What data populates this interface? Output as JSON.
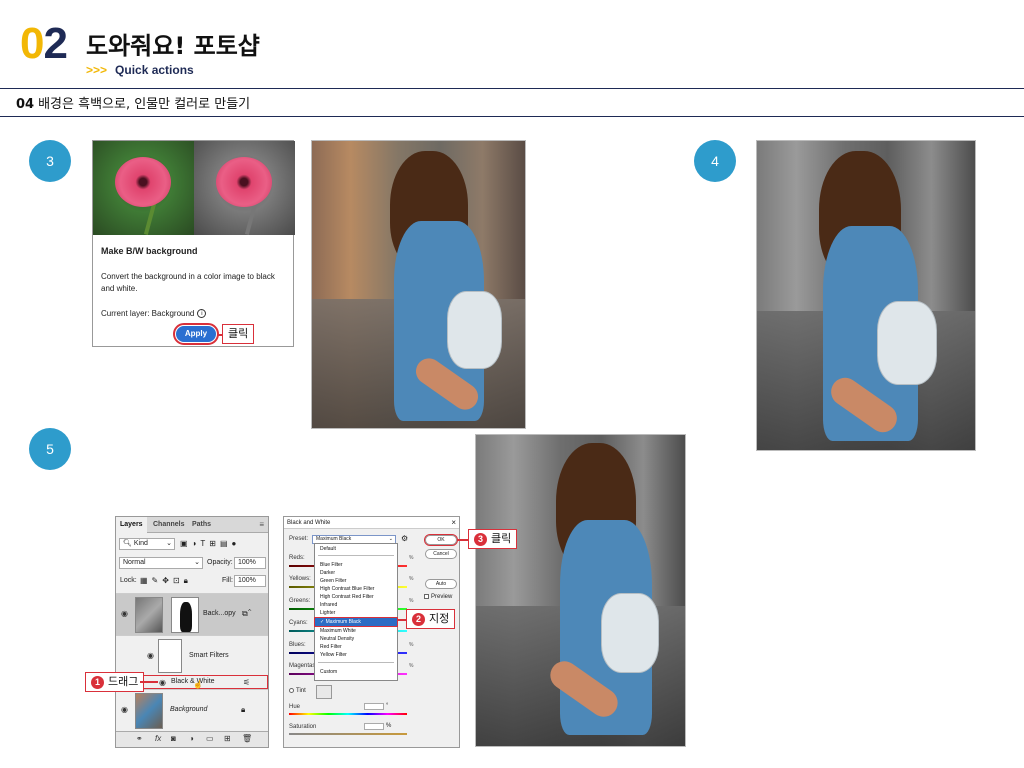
{
  "header": {
    "chapter_num_first": "0",
    "chapter_num_second": "2",
    "title": "도와줘요! 포토샵",
    "sub_arrows": ">>>",
    "subtitle": "Quick actions",
    "section_num": "04",
    "section_title": "배경은 흑백으로, 인물만 컬러로 만들기"
  },
  "steps": {
    "s3": "3",
    "s4": "4",
    "s5": "5"
  },
  "quick_action": {
    "heading": "Make B/W background",
    "description": "Convert the background in a color image to black and white.",
    "current_layer": "Current layer: Background",
    "info_icon": "i",
    "apply_label": "Apply",
    "callout": "클릭"
  },
  "layers_panel": {
    "tabs": [
      "Layers",
      "Channels",
      "Paths"
    ],
    "kind": "Kind",
    "blend_mode": "Normal",
    "opacity_label": "Opacity:",
    "opacity_value": "100%",
    "lock_label": "Lock:",
    "fill_label": "Fill:",
    "fill_value": "100%",
    "layer_copy": "Back...opy",
    "smart_filters": "Smart Filters",
    "bw_filter": "Black & White",
    "background": "Background",
    "callout_num": "1",
    "callout_text": "드래그"
  },
  "bw_dialog": {
    "title": "Black and White",
    "close": "×",
    "preset_label": "Preset:",
    "preset_value": "Maximum Black",
    "options": [
      "Default",
      "Blue Filter",
      "Darker",
      "Green Filter",
      "High Contrast Blue Filter",
      "High Contrast Red Filter",
      "Infrared",
      "Lighter",
      "✓ Maximum Black",
      "Maximum White",
      "Neutral Density",
      "Red Filter",
      "Yellow Filter",
      "Custom"
    ],
    "slider_labels": [
      "Reds:",
      "Yellows:",
      "Greens:",
      "Cyans:",
      "Blues:",
      "Magentas:"
    ],
    "pct": "%",
    "ok": "OK",
    "cancel": "Cancel",
    "auto": "Auto",
    "preview": "Preview",
    "tint": "Tint",
    "hue": "Hue",
    "deg": "°",
    "saturation": "Saturation",
    "callout2_num": "2",
    "callout2_text": "지정",
    "callout3_num": "3",
    "callout3_text": "클릭"
  },
  "colors": {
    "accent_yellow": "#f2b705",
    "navy": "#1e2a55",
    "step_blue": "#2e9ccc",
    "callout_red": "#d9303a"
  }
}
